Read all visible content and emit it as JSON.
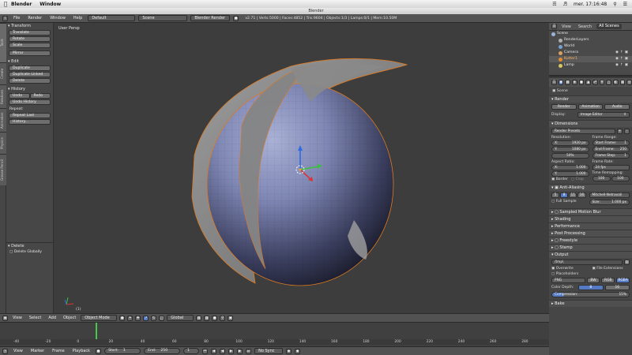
{
  "os": {
    "app_name": "Blender",
    "menu": [
      "Window"
    ],
    "clock": "mer. 17:16:48"
  },
  "window": {
    "title": "Blender"
  },
  "info_header": {
    "menus": [
      "File",
      "Render",
      "Window",
      "Help"
    ],
    "screen_layout": "Default",
    "scene": "Scene",
    "engine": "Blender Render",
    "stats": "v2.71 | Verts:5000 | Faces:4852 | Tris:9604 | Objects:1/3 | Lamps:0/1 | Mem:10.50M"
  },
  "toolshelf": {
    "tabs": [
      "Tools",
      "Create",
      "Relations",
      "Animation",
      "Physics",
      "Grease Pencil"
    ],
    "transform_header": "Transform",
    "transform_buttons": [
      "Translate",
      "Rotate",
      "Scale"
    ],
    "mirror_button": "Mirror",
    "edit_header": "Edit",
    "edit_buttons": [
      "Duplicate",
      "Duplicate Linked",
      "Delete"
    ],
    "history_header": "History",
    "undo": "Undo",
    "redo": "Redo",
    "undo_history": "Undo History",
    "repeat_label": "Repeat:",
    "repeat_buttons": [
      "Repeat Last",
      "History..."
    ],
    "delete_header": "Delete",
    "delete_globally": "Delete Globally"
  },
  "viewport": {
    "view_label": "User Persp",
    "object_label": "(1)"
  },
  "view3d_header": {
    "menus": [
      "View",
      "Select",
      "Add",
      "Object"
    ],
    "mode": "Object Mode",
    "orientation": "Global"
  },
  "timeline": {
    "ticks": [
      "-40",
      "-20",
      "0",
      "20",
      "40",
      "60",
      "80",
      "100",
      "120",
      "140",
      "160",
      "180",
      "200",
      "220",
      "240",
      "260",
      "280"
    ],
    "menus": [
      "View",
      "Marker",
      "Frame",
      "Playback"
    ],
    "start_label": "Start:",
    "start_value": "1",
    "end_label": "End:",
    "end_value": "250",
    "current_frame": "1",
    "sync": "No Sync"
  },
  "outliner": {
    "tabs": [
      "View",
      "Search",
      "All Scenes"
    ],
    "items": [
      {
        "label": "Scene",
        "color": "#9db4d8"
      },
      {
        "label": "RenderLayers",
        "color": "#b0b0b0"
      },
      {
        "label": "World",
        "color": "#7aa0d0"
      },
      {
        "label": "Camera",
        "color": "#d8a060"
      },
      {
        "label": "Kutter1",
        "color": "#e48a2e"
      },
      {
        "label": "Lamp",
        "color": "#d8c860"
      }
    ]
  },
  "properties": {
    "breadcrumb": "Scene",
    "render_header": "Render",
    "render_buttons": [
      "Render",
      "Animation",
      "Audio"
    ],
    "display_label": "Display:",
    "display_value": "Image Editor",
    "dimensions_header": "Dimensions",
    "render_presets": "Render Presets",
    "resolution_label": "Resolution:",
    "res_x": {
      "label": "X:",
      "value": "1920 px"
    },
    "res_y": {
      "label": "Y:",
      "value": "1080 px"
    },
    "res_pct": "50%",
    "frame_range_label": "Frame Range:",
    "start_frame": {
      "label": "Start Frame:",
      "value": "1"
    },
    "end_frame": {
      "label": "End Frame:",
      "value": "250"
    },
    "frame_step": {
      "label": "Frame Step:",
      "value": "1"
    },
    "aspect_label": "Aspect Ratio:",
    "aspect_x": {
      "label": "X:",
      "value": "1.000"
    },
    "aspect_y": {
      "label": "Y:",
      "value": "1.000"
    },
    "frame_rate_label": "Frame Rate:",
    "frame_rate": "24 fps",
    "time_remap_label": "Time Remapping:",
    "time_old": "100",
    "time_new": "100",
    "border": "Border",
    "crop": "Crop",
    "aa_header": "Anti-Aliasing",
    "aa_samples": [
      "5",
      "8",
      "11",
      "16"
    ],
    "aa_filter": "Mitchell-Netravali",
    "full_sample": "Full Sample",
    "aa_size": {
      "label": "Size:",
      "value": "1.000 px"
    },
    "collapsed_panels": [
      "Sampled Motion Blur",
      "Shading",
      "Performance",
      "Post Processing",
      "Freestyle",
      "Stamp"
    ],
    "output_header": "Output",
    "output_path": "/tmp\\",
    "overwrite": "Overwrite",
    "file_extensions": "File Extensions",
    "placeholders": "Placeholders",
    "file_format": "PNG",
    "color_modes": [
      "BW",
      "RGB",
      "RGBA"
    ],
    "color_depth_label": "Color Depth:",
    "color_depths": [
      "8",
      "16"
    ],
    "compression": {
      "label": "Compression:",
      "value": "15%"
    },
    "bake_header": "Bake"
  }
}
